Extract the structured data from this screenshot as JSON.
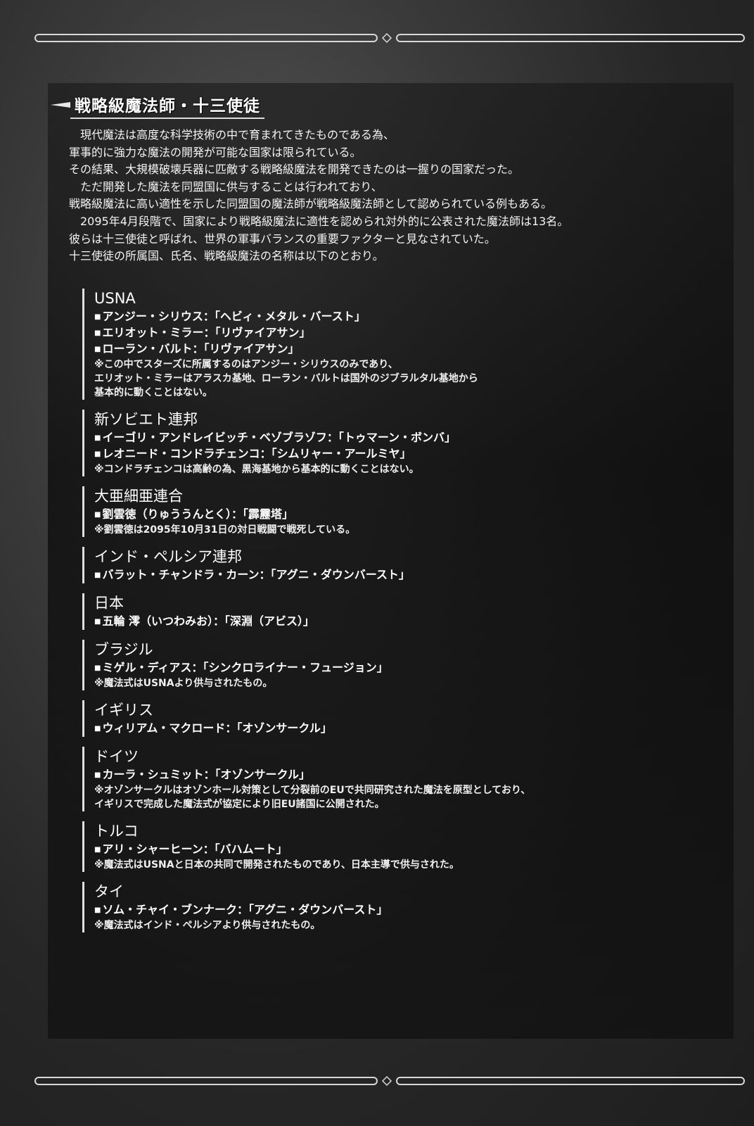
{
  "section_title": "戦略級魔法師・十三使徒",
  "intro": [
    "現代魔法は高度な科学技術の中で育まれてきたものである為、",
    "軍事的に強力な魔法の開発が可能な国家は限られている。",
    "その結果、大規模破壊兵器に匹敵する戦略級魔法を開発できたのは一握りの国家だった。",
    "ただ開発した魔法を同盟国に供与することは行われており、",
    "戦略級魔法に高い適性を示した同盟国の魔法師が戦略級魔法師として認められている例もある。",
    "2095年4月段階で、国家により戦略級魔法に適性を認められ対外的に公表された魔法師は13名。",
    "彼らは十三使徒と呼ばれ、世界の軍事バランスの重要ファクターと見なされていた。",
    "十三使徒の所属国、氏名、戦略級魔法の名称は以下のとおり。"
  ],
  "bullet": "■",
  "countries": [
    {
      "name": "USNA",
      "members": [
        "アンジー・シリウス：「ヘビィ・メタル・バースト」",
        "エリオット・ミラー：「リヴァイアサン」",
        "ローラン・バルト：「リヴァイアサン」"
      ],
      "notes": [
        "※この中でスターズに所属するのはアンジー・シリウスのみであり、",
        "エリオット・ミラーはアラスカ基地、ローラン・バルトは国外のジブラルタル基地から",
        "基本的に動くことはない。"
      ]
    },
    {
      "name": "新ソビエト連邦",
      "members": [
        "イーゴリ・アンドレイビッチ・ベゾブラゾフ：「トゥマーン・ボンバ」",
        "レオニード・コンドラチェンコ：「シムリャー・アールミヤ」"
      ],
      "notes": [
        "※コンドラチェンコは高齢の為、黒海基地から基本的に動くことはない。"
      ]
    },
    {
      "name": "大亜細亜連合",
      "members": [
        "劉雲徳（りゅううんとく）：「霹靂塔」"
      ],
      "notes": [
        "※劉雲徳は2095年10月31日の対日戦闘で戦死している。"
      ]
    },
    {
      "name": "インド・ペルシア連邦",
      "members": [
        "バラット・チャンドラ・カーン：「アグニ・ダウンバースト」"
      ],
      "notes": []
    },
    {
      "name": "日本",
      "members": [
        "五輪 澪（いつわみお）：「深淵（アビス）」"
      ],
      "notes": []
    },
    {
      "name": "ブラジル",
      "members": [
        "ミゲル・ディアス：「シンクロライナー・フュージョン」"
      ],
      "notes": [
        "※魔法式はUSNAより供与されたもの。"
      ]
    },
    {
      "name": "イギリス",
      "members": [
        "ウィリアム・マクロード：「オゾンサークル」"
      ],
      "notes": []
    },
    {
      "name": "ドイツ",
      "members": [
        "カーラ・シュミット：「オゾンサークル」"
      ],
      "notes": [
        "※オゾンサークルはオゾンホール対策として分裂前のEUで共同研究された魔法を原型としており、",
        "イギリスで完成した魔法式が協定により旧EU諸国に公開された。"
      ]
    },
    {
      "name": "トルコ",
      "members": [
        "アリ・シャーヒーン：「バハムート」"
      ],
      "notes": [
        "※魔法式はUSNAと日本の共同で開発されたものであり、日本主導で供与された。"
      ]
    },
    {
      "name": "タイ",
      "members": [
        "ソム・チャイ・ブンナーク：「アグニ・ダウンバースト」"
      ],
      "notes": [
        "※魔法式はインド・ペルシアより供与されたもの。"
      ]
    }
  ]
}
